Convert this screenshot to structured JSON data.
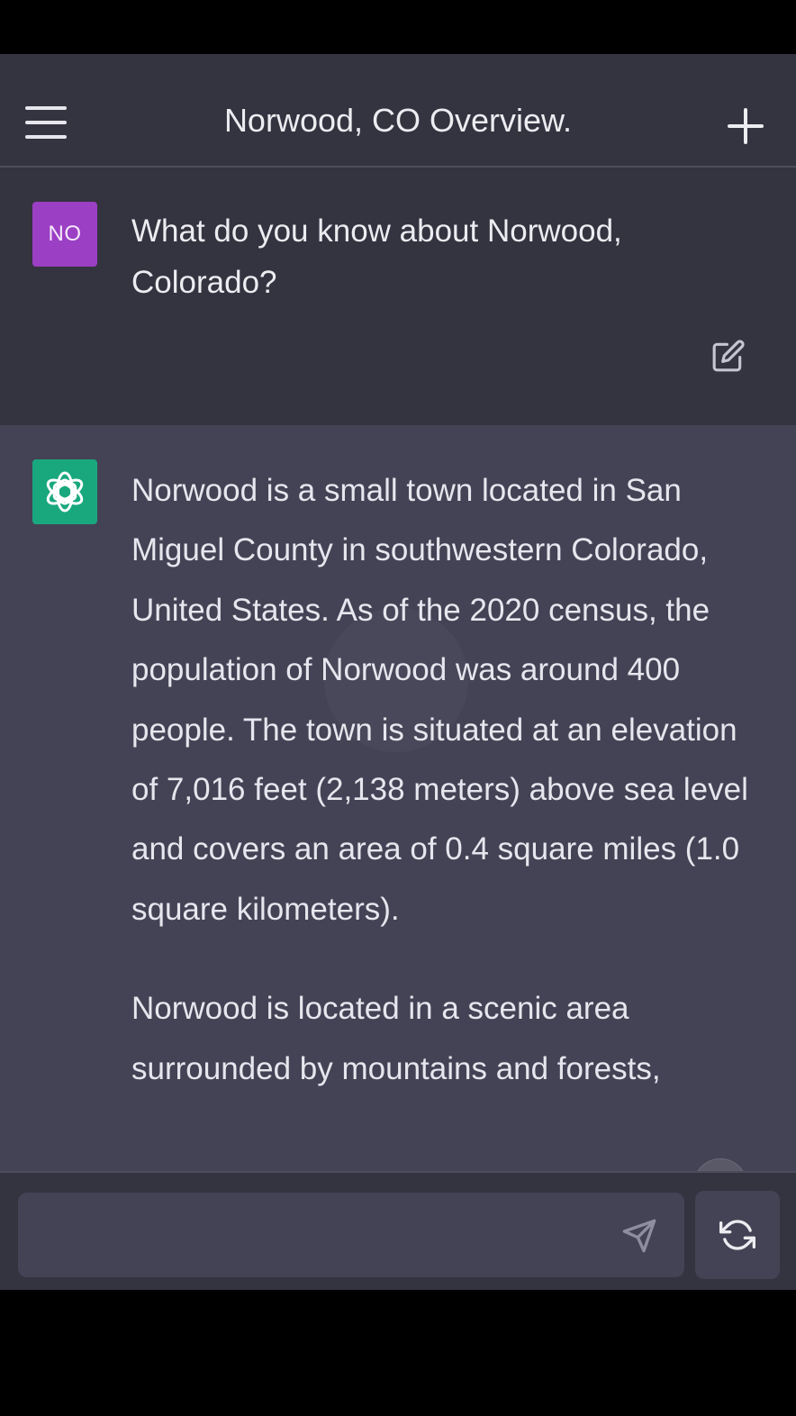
{
  "header": {
    "title": "Norwood, CO Overview."
  },
  "icons": {
    "menu": "menu-icon",
    "new_chat": "plus-icon",
    "edit": "edit-icon",
    "assistant_logo": "openai-logo-icon",
    "scroll_down": "arrow-down-icon",
    "send": "send-icon",
    "regenerate": "refresh-icon"
  },
  "user_message": {
    "avatar_initials": "NO",
    "avatar_color": "#9b3fc4",
    "text": "What do you know about Norwood, Colorado?"
  },
  "assistant_message": {
    "avatar_color": "#19a87e",
    "paragraphs": [
      "Norwood is a small town located in San Miguel County in southwestern Colorado, United States. As of the 2020 census, the population of Norwood was around 400 people. The town is situated at an elevation of 7,016 feet (2,138 meters) above sea level and covers an area of 0.4 square miles (1.0 square kilometers).",
      "Norwood is located in a scenic area surrounded by mountains and forests,"
    ]
  },
  "composer": {
    "value": "",
    "placeholder": ""
  }
}
